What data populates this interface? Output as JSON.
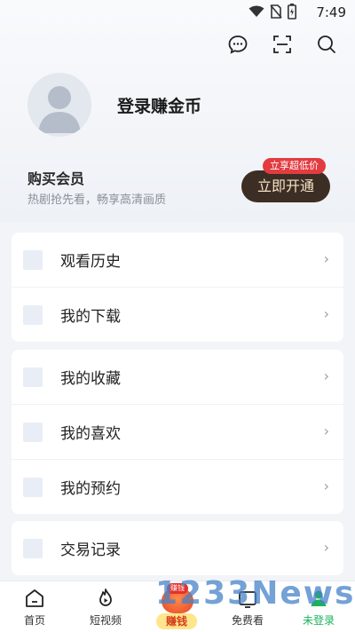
{
  "status_bar": {
    "time": "7:49"
  },
  "header": {
    "icons": [
      "message-icon",
      "scan-icon",
      "search-icon"
    ]
  },
  "profile": {
    "login_label": "登录赚金币"
  },
  "vip": {
    "title": "购买会员",
    "subtitle": "热剧抢先看，畅享高清画质",
    "badge": "立享超低价",
    "button": "立即开通"
  },
  "menu_groups": [
    {
      "items": [
        {
          "label": "观看历史"
        },
        {
          "label": "我的下载"
        }
      ]
    },
    {
      "items": [
        {
          "label": "我的收藏"
        },
        {
          "label": "我的喜欢"
        },
        {
          "label": "我的预约"
        }
      ]
    },
    {
      "items": [
        {
          "label": "交易记录"
        }
      ]
    }
  ],
  "bottom_nav": {
    "home": "首页",
    "short_video": "短视频",
    "earn": "赚钱",
    "earn_badge": "赚钱",
    "free": "免费看",
    "login": "未登录"
  },
  "watermark": "1233News",
  "colors": {
    "accent_green": "#1ab35a",
    "vip_button": "#3d2e25",
    "badge_red": "#e23b40"
  }
}
